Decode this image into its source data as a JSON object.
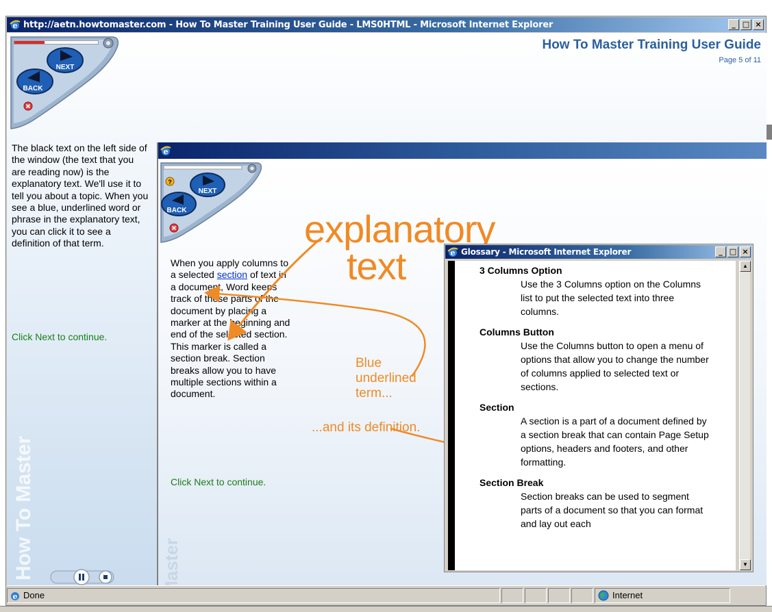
{
  "window": {
    "title": "http://aetn.howtomaster.com - How To Master Training User Guide - LMS0HTML - Microsoft Internet Explorer",
    "btn_minimize": "_",
    "btn_maximize": "□",
    "btn_close": "×"
  },
  "header": {
    "title": "How To Master Training User Guide",
    "page": "Page 5 of 11"
  },
  "controls": {
    "next": "NEXT",
    "back": "BACK",
    "progress": 0.36
  },
  "left": {
    "text": "The black text on the left side of the window (the text that you are reading now) is the explanatory text. We'll use it to tell you about a topic. When you see a blue, underlined word or phrase in the explanatory text, you can click it to see a definition of that term.",
    "next_hint": "Click Next to continue."
  },
  "watermark": "How To Master",
  "inner": {
    "text_before": "When you apply columns to a selected ",
    "term": "section",
    "text_after": " of text in a document, Word keeps track of these parts of the document by placing a marker at the beginning and end of the selected section. This marker is called a section break. Section breaks allow you to have multiple sections within a document.",
    "next_hint": "Click Next to continue.",
    "watermark": "Master",
    "annotation_big_1": "explanatory",
    "annotation_big_2": "text",
    "annotation_blue_1": "Blue",
    "annotation_blue_2": "underlined",
    "annotation_blue_3": "term...",
    "annotation_def": "...and its definition."
  },
  "glossary": {
    "title": "Glossary - Microsoft Internet Explorer",
    "entries": [
      {
        "term": "3 Columns Option",
        "definition": "Use the 3 Columns option on the Columns list to put the selected text into three columns."
      },
      {
        "term": "Columns Button",
        "definition": "Use the Columns button to open a menu of options that allow you to change the number of columns applied to selected text or sections."
      },
      {
        "term": "Section",
        "definition": "A section is a part of a document defined by a section break that can contain Page Setup options, headers and footers, and other formatting."
      },
      {
        "term": "Section Break",
        "definition": "Section breaks can be used to segment parts of a document so that you can format and lay out each"
      }
    ]
  },
  "status": {
    "done": "Done",
    "zone": "Internet"
  },
  "colors": {
    "accent_orange": "#f08a24",
    "title_blue": "#2b5f9e",
    "link_blue": "#0033cc",
    "next_green": "#1a7d1a"
  }
}
